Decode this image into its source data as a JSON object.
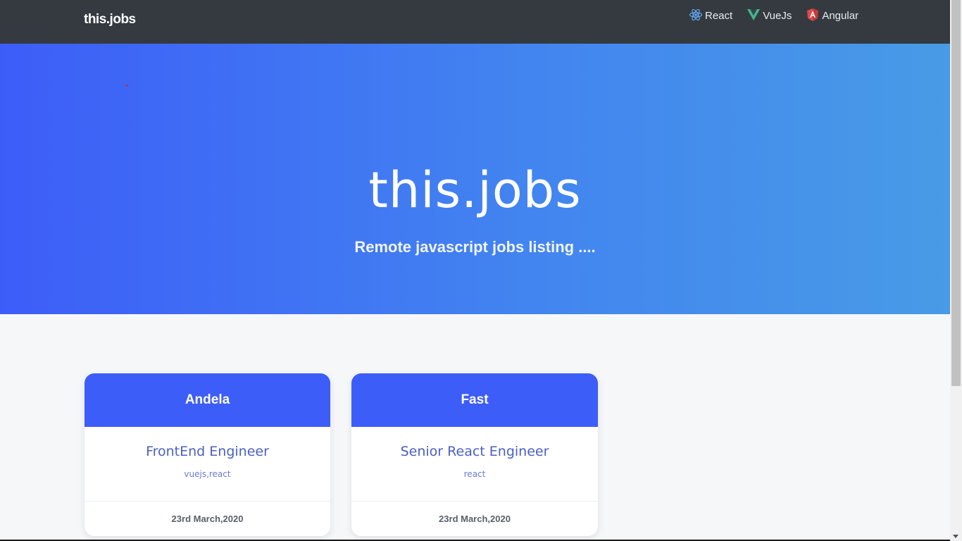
{
  "navbar": {
    "brand": "this.jobs",
    "links": [
      {
        "label": "React",
        "icon": "react-icon",
        "color": "#61a8f0"
      },
      {
        "label": "VueJs",
        "icon": "vue-icon",
        "color": "#42b883"
      },
      {
        "label": "Angular",
        "icon": "angular-icon",
        "color": "#dd0031"
      }
    ]
  },
  "hero": {
    "title": "this.jobs",
    "subtitle": "Remote javascript jobs listing ...."
  },
  "jobs": [
    {
      "company": "Andela",
      "title": "FrontEnd Engineer",
      "tags": "vuejs,react",
      "date": "23rd March,2020"
    },
    {
      "company": "Fast",
      "title": "Senior React Engineer",
      "tags": "react",
      "date": "23rd March,2020"
    }
  ],
  "colors": {
    "navbar_bg": "#343a40",
    "hero_gradient_start": "#3d5df8",
    "hero_gradient_end": "#489be6",
    "card_header": "#3d5df8",
    "page_bg": "#f6f7f9"
  }
}
